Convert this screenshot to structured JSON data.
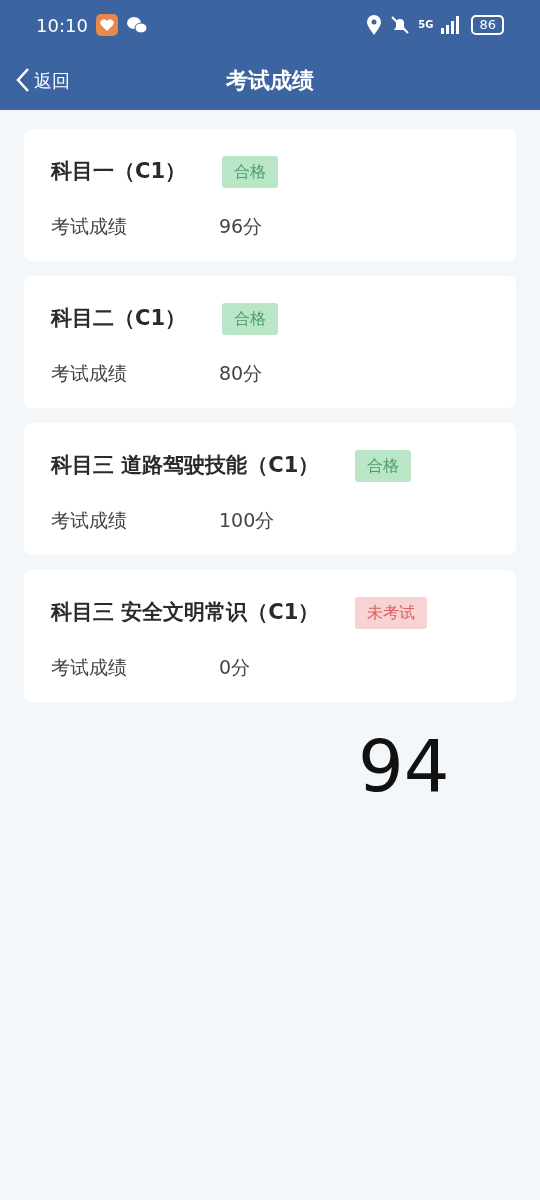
{
  "status_bar": {
    "time": "10:10",
    "network": "5G",
    "battery": "86"
  },
  "nav": {
    "back": "返回",
    "title": "考试成绩"
  },
  "exams": [
    {
      "title": "科目一（C1）",
      "badge": {
        "kind": "passed",
        "text": "合格"
      },
      "label": "考试成绩",
      "score": "96分"
    },
    {
      "title": "科目二（C1）",
      "badge": {
        "kind": "passed",
        "text": "合格"
      },
      "label": "考试成绩",
      "score": "80分"
    },
    {
      "title": "科目三 道路驾驶技能（C1）",
      "badge": {
        "kind": "passed",
        "text": "合格"
      },
      "label": "考试成绩",
      "score": "100分"
    },
    {
      "title": "科目三 安全文明常识（C1）",
      "badge": {
        "kind": "untested",
        "text": "未考试"
      },
      "label": "考试成绩",
      "score": "0分"
    }
  ],
  "overlay": {
    "text": "94"
  }
}
